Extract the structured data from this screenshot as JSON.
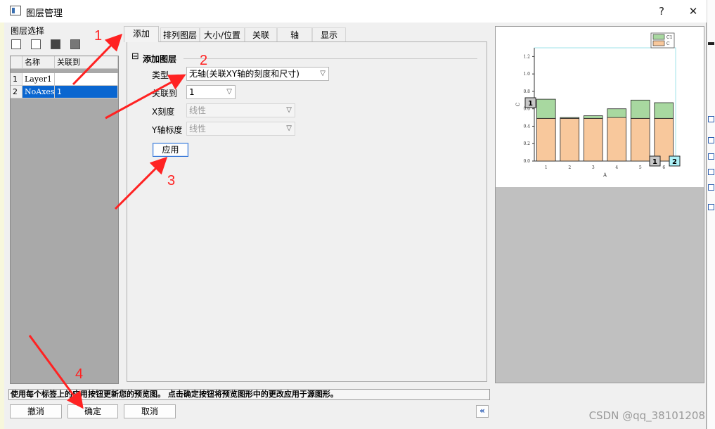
{
  "window": {
    "title": "图层管理",
    "help_button": "?",
    "close_button": "✕"
  },
  "layer_select": {
    "label": "图层选择"
  },
  "layer_grid": {
    "columns": [
      "名称",
      "关联到"
    ],
    "rows": [
      {
        "index": "1",
        "name": "Layer1",
        "link": ""
      },
      {
        "index": "2",
        "name": "NoAxes",
        "link": "1"
      }
    ]
  },
  "tabs": [
    "添加",
    "排列图层",
    "大小/位置",
    "关联",
    "轴",
    "显示"
  ],
  "add_panel": {
    "group_title": "添加图层",
    "group_toggle": "⊟",
    "type_label": "类型",
    "type_value": "无轴(关联XY轴的刻度和尺寸)",
    "link_label": "关联到",
    "link_value": "1",
    "x_scale_label": "X刻度",
    "x_scale_value": "线性",
    "y_scale_label": "Y轴标度",
    "y_scale_value": "线性",
    "apply_button": "应用"
  },
  "status_text": "使用每个标签上的应用按钮更新您的预览图。 点击确定按钮将预览图形中的更改应用于源图形。",
  "footer": {
    "cancel_left": "撤消",
    "ok": "确定",
    "cancel": "取消",
    "collapse": "«"
  },
  "annotations": [
    "1",
    "2",
    "3",
    "4"
  ],
  "watermark": "CSDN @qq_38101208",
  "chart_data": {
    "type": "bar",
    "categories": [
      "1",
      "2",
      "3",
      "4",
      "5",
      "6"
    ],
    "series": [
      {
        "name": "C",
        "values": [
          0.49,
          0.49,
          0.49,
          0.5,
          0.49,
          0.49
        ],
        "color": "#f8c89c"
      },
      {
        "name": "C1",
        "values": [
          0.22,
          0.01,
          0.03,
          0.1,
          0.21,
          0.18
        ],
        "color": "#a8d8a0"
      }
    ],
    "xlabel": "A",
    "ylabel": "C",
    "yticks": [
      "0.0",
      "0.2",
      "0.4",
      "0.6",
      "0.8",
      "1.0",
      "1.2"
    ],
    "ylim": [
      0,
      1.3
    ],
    "stacked": true,
    "legend": "top-right",
    "layer_markers": [
      "1",
      "1",
      "2"
    ]
  }
}
